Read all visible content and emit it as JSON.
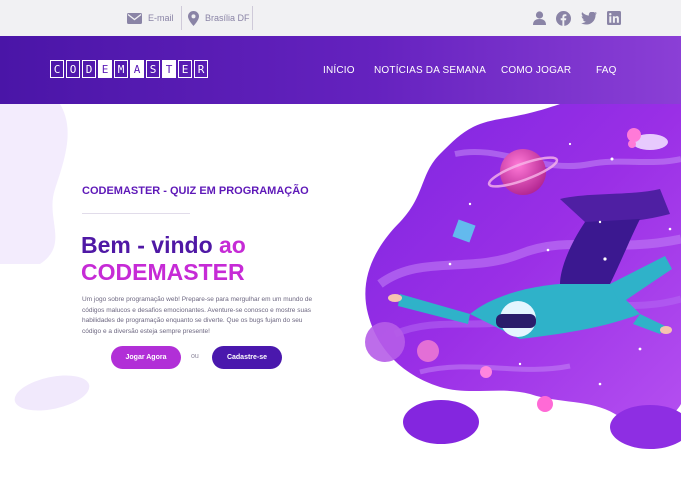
{
  "topbar": {
    "email_label": "E-mail",
    "location_label": "Brasília DF",
    "social": [
      "user-icon",
      "facebook-icon",
      "twitter-icon",
      "linkedin-icon"
    ]
  },
  "header": {
    "logo_letters": [
      "C",
      "O",
      "D",
      "E",
      "M",
      "A",
      "S",
      "T",
      "E",
      "R"
    ],
    "nav": [
      {
        "label": "INÍCIO"
      },
      {
        "label": "NOTÍCIAS DA SEMANA"
      },
      {
        "label": "COMO JOGAR"
      },
      {
        "label": "FAQ"
      }
    ]
  },
  "hero": {
    "subtitle": "CODEMASTER - QUIZ EM PROGRAMAÇÃO",
    "title_part1": "Bem - vindo",
    "title_part2": "ao",
    "title_line2": "CODEMASTER",
    "paragraph": "Um jogo sobre programação web! Prepare-se para mergulhar em um mundo de códigos malucos e desafios emocionantes. Aventure-se conosco e mostre suas habilidades de programação enquanto se diverte. Que os bugs fujam do seu código e a diversão esteja sempre presente!",
    "primary_button": "Jogar Agora",
    "separator": "ou",
    "secondary_button": "Cadastre-se"
  },
  "colors": {
    "brand_purple": "#4a15a7",
    "accent_magenta": "#c62bd6",
    "topbar_bg": "#f1f1f3"
  }
}
